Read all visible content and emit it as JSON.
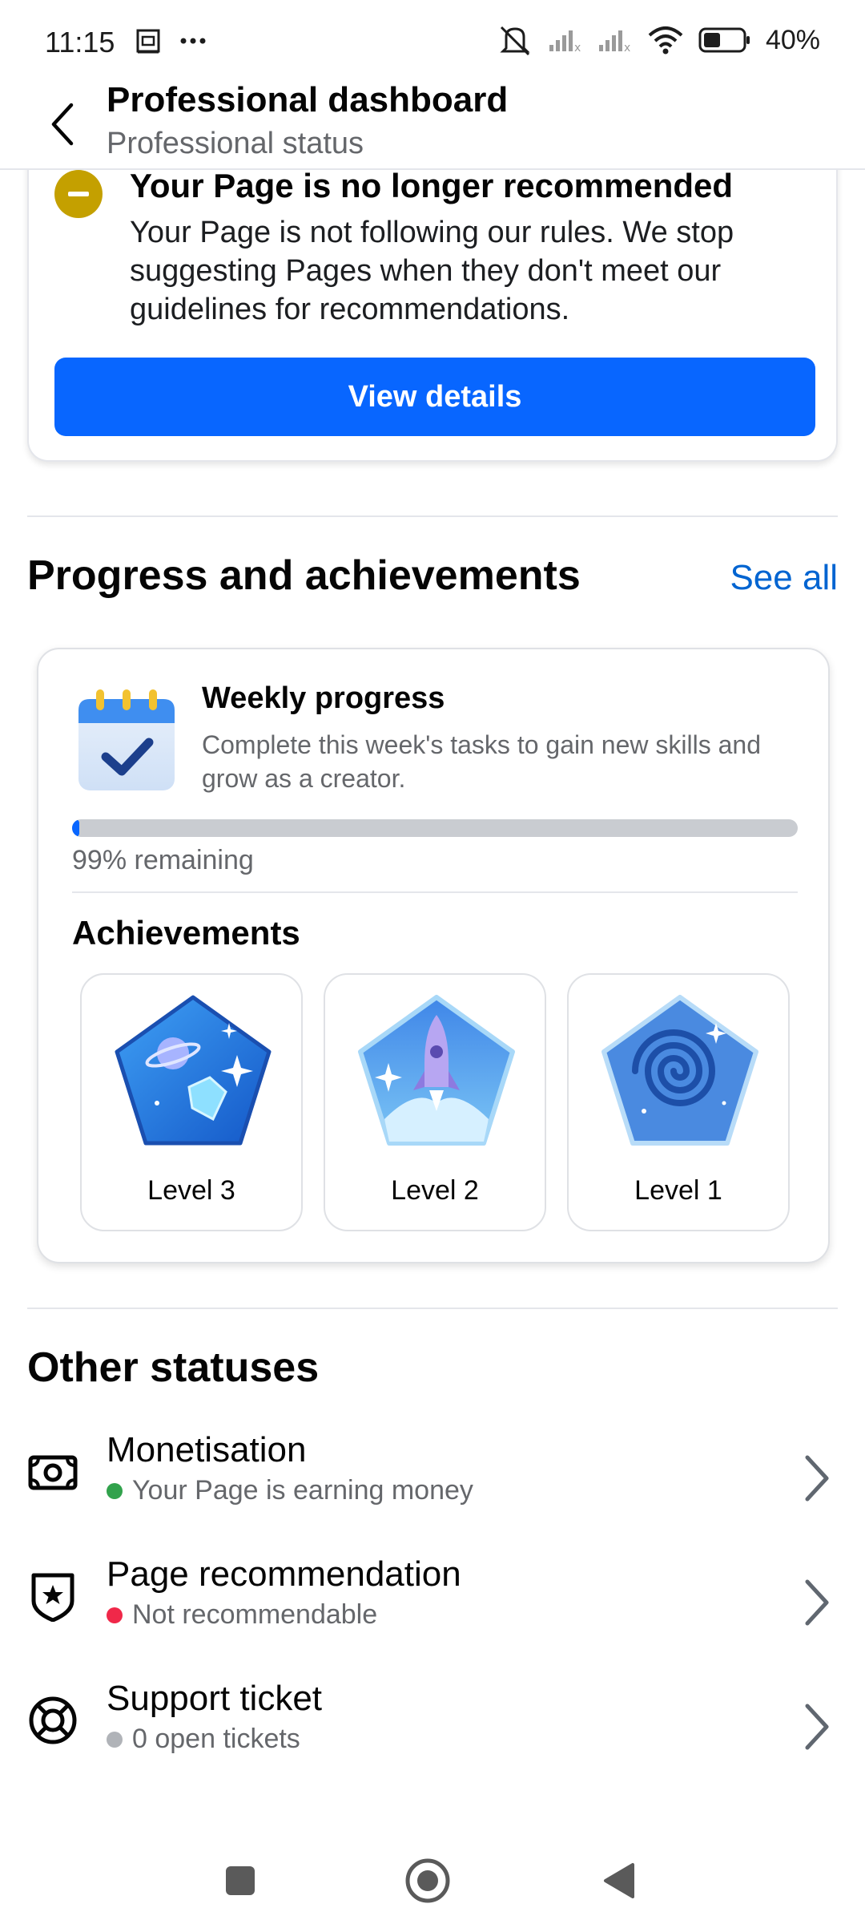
{
  "status_bar": {
    "time": "11:15",
    "battery": "40%",
    "icons": [
      "screenshot-icon",
      "more-icon",
      "mute-icon",
      "signal-icon",
      "signal-icon",
      "wifi-icon",
      "battery-icon"
    ]
  },
  "header": {
    "title": "Professional dashboard",
    "subtitle": "Professional status",
    "back_icon": "chevron-left-icon"
  },
  "recommendation": {
    "title": "Your Page is no longer recommended",
    "body": "Your Page is not following our rules. We stop suggesting Pages when they don't meet our guidelines for recommendations.",
    "button": "View details",
    "icon": "minus-circle-icon",
    "icon_color": "#c4a000"
  },
  "progress_section": {
    "title": "Progress and achievements",
    "see_all": "See all",
    "weekly": {
      "title": "Weekly progress",
      "description": "Complete this week's tasks to gain new skills and grow as a creator.",
      "remaining_text": "99% remaining",
      "progress_fraction": 0.01
    },
    "achievements": {
      "title": "Achievements",
      "badges": [
        {
          "label": "Level 3",
          "icon": "planet-diamond-badge-icon"
        },
        {
          "label": "Level 2",
          "icon": "rocket-badge-icon"
        },
        {
          "label": "Level 1",
          "icon": "galaxy-badge-icon"
        }
      ]
    }
  },
  "other_statuses": {
    "title": "Other statuses",
    "items": [
      {
        "title": "Monetisation",
        "status": "Your Page is earning money",
        "dot_color": "#31a24c",
        "icon": "money-icon"
      },
      {
        "title": "Page recommendation",
        "status": "Not recommendable",
        "dot_color": "#f02849",
        "icon": "shield-star-icon"
      },
      {
        "title": "Support ticket",
        "status": "0 open tickets",
        "dot_color": "#b0b3b8",
        "icon": "lifebuoy-icon"
      }
    ]
  },
  "nav_bar": {
    "items": [
      "recents-icon",
      "home-icon",
      "back-icon"
    ]
  },
  "colors": {
    "accent": "#0866ff",
    "link": "#0064d1",
    "text_secondary": "#65676b"
  }
}
